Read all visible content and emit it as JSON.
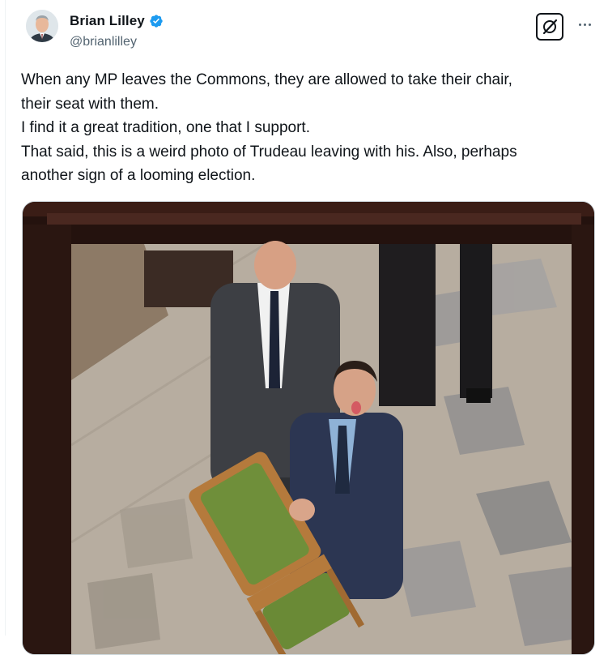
{
  "author": {
    "display_name": "Brian Lilley",
    "handle": "@brianlilley",
    "verified": true,
    "avatar_icon": "profile-photo"
  },
  "actions": {
    "grok_icon": "grok-icon",
    "more_icon": "more-options-icon"
  },
  "tweet": {
    "lines": [
      "When any MP leaves the Commons, they are allowed to take their chair,",
      "their seat with them.",
      "I find it a great tradition, one that I support.",
      "That said, this is a weird photo of Trudeau leaving with his. Also, perhaps",
      "another sign of a looming election."
    ]
  },
  "media": {
    "subject": "photo of a man carrying a green upholstered chair, framed by a dark doorway"
  },
  "colors": {
    "verified_badge": "#1d9bf0",
    "secondary_text": "#536471",
    "chair_upholstery": "#6f8f3a",
    "chair_wood": "#b57a3c"
  }
}
